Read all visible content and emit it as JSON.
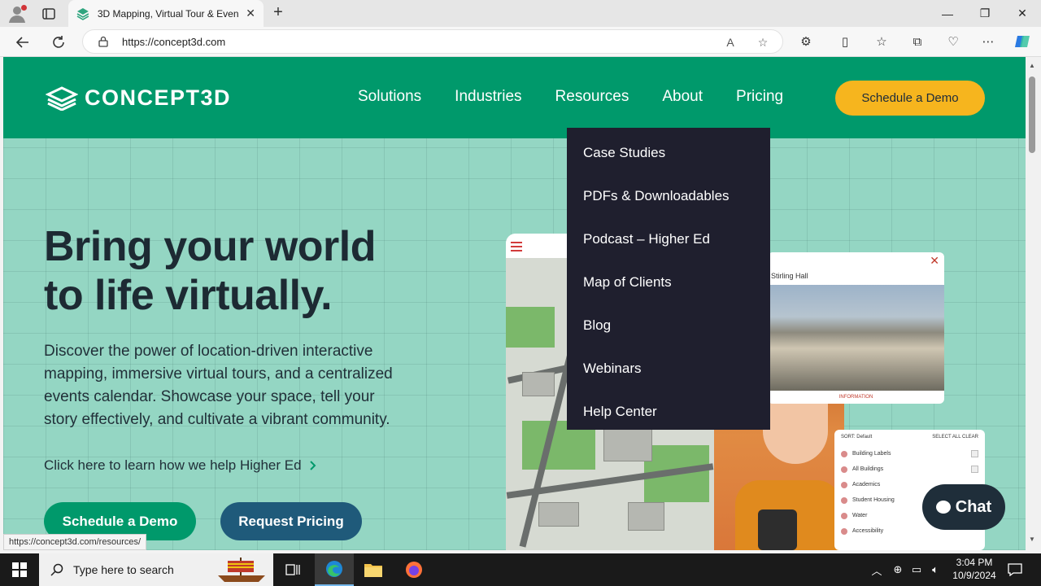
{
  "browser": {
    "tab_title": "3D Mapping, Virtual Tour & Even",
    "url": "https://concept3d.com",
    "status_url": "https://concept3d.com/resources/"
  },
  "site": {
    "logo_text": "CONCEPT3D",
    "nav": [
      "Solutions",
      "Industries",
      "Resources",
      "About",
      "Pricing"
    ],
    "cta_top": "Schedule a Demo",
    "colors": {
      "brand_green": "#00996b",
      "accent_yellow": "#f6b51e",
      "dark_blue": "#1f5a7a",
      "dropdown_bg": "#1f1f2e",
      "hero_bg": "#94d6c3"
    }
  },
  "hero": {
    "title_line1": "Bring your world",
    "title_line2": "to life virtually.",
    "subtitle": "Discover the power of location-driven interactive mapping, immersive virtual tours, and a centralized events calendar. Showcase your space, tell your story effectively, and cultivate a vibrant community.",
    "higher_ed_link": "Click here to learn how we help Higher Ed",
    "btn_demo": "Schedule a Demo",
    "btn_pricing": "Request Pricing"
  },
  "graphics": {
    "photo_label": "Stirling Hall",
    "photo_info": "INFORMATION",
    "filter": {
      "sort_label": "SORT:",
      "sort_value": "Default",
      "select_all": "SELECT ALL",
      "clear": "CLEAR",
      "rows": [
        "Building Labels",
        "All Buildings",
        "Academics",
        "Student Housing",
        "Water",
        "Accessibility"
      ]
    }
  },
  "dropdown": {
    "items": [
      "Case Studies",
      "PDFs & Downloadables",
      "Podcast – Higher Ed",
      "Map of Clients",
      "Blog",
      "Webinars",
      "Help Center"
    ]
  },
  "chat": {
    "label": "Chat"
  },
  "taskbar": {
    "search_placeholder": "Type here to search",
    "time": "3:04 PM",
    "date": "10/9/2024"
  }
}
